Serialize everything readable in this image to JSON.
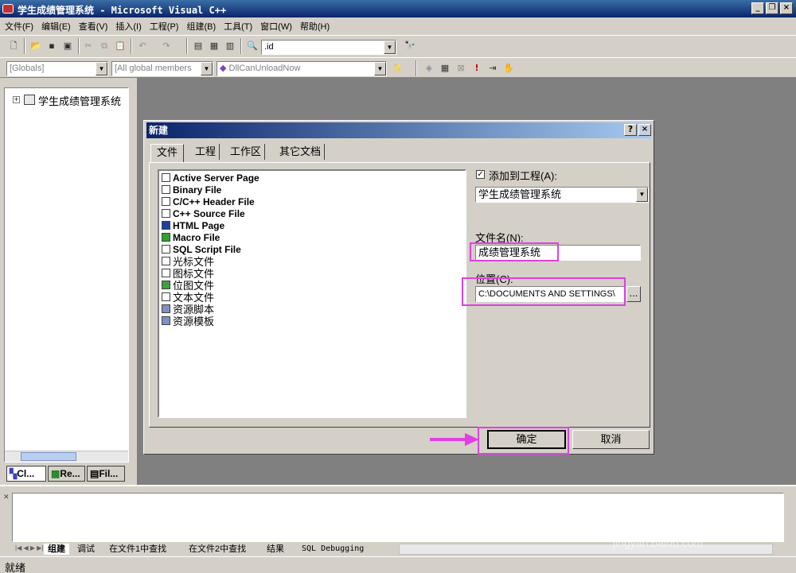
{
  "window": {
    "title": "学生成绩管理系统 - Microsoft Visual C++"
  },
  "menu": [
    "文件(F)",
    "编辑(E)",
    "查看(V)",
    "插入(I)",
    "工程(P)",
    "组建(B)",
    "工具(T)",
    "窗口(W)",
    "帮助(H)"
  ],
  "toolbar": {
    "find_value": ".id",
    "globals": "[Globals]",
    "members": "[All global members",
    "function": "DllCanUnloadNow"
  },
  "workspace": {
    "tree_root": "学生成绩管理系统",
    "tabs": [
      "Cl...",
      "Re...",
      "Fil..."
    ]
  },
  "dialog": {
    "title": "新建",
    "tabs": [
      "文件",
      "工程",
      "工作区",
      "其它文档"
    ],
    "file_types": [
      "Active Server Page",
      "Binary File",
      "C/C++ Header File",
      "C++ Source File",
      "HTML Page",
      "Macro File",
      "SQL Script File",
      "光标文件",
      "图标文件",
      "位图文件",
      "文本文件",
      "资源脚本",
      "资源模板"
    ],
    "add_to_project_label": "添加到工程(A):",
    "add_to_project_checked": true,
    "project_value": "学生成绩管理系统",
    "filename_label": "文件名(N):",
    "filename_value": "成绩管理系统",
    "location_label": "位置(C):",
    "location_value": "C:\\DOCUMENTS AND SETTINGS\\",
    "browse_label": "...",
    "ok_label": "确定",
    "cancel_label": "取消"
  },
  "output": {
    "tabs": [
      "组建",
      "调试",
      "在文件1中查找",
      "在文件2中查找",
      "结果",
      "SQL Debugging"
    ]
  },
  "watermark": {
    "brand": "Bai du 经验",
    "url": "jingyan.baidu.com"
  },
  "status": {
    "text": "就绪"
  },
  "colors": {
    "accent": "#0a246a",
    "highlight": "#e040e0"
  }
}
